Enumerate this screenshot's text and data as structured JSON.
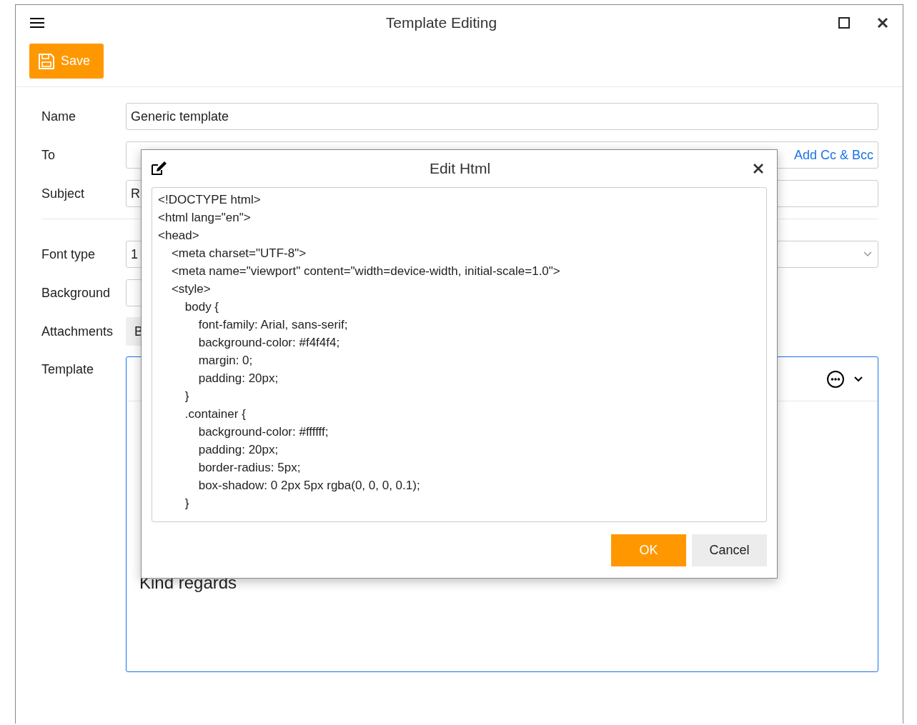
{
  "window": {
    "title": "Template Editing"
  },
  "toolbar": {
    "save_label": "Save"
  },
  "form": {
    "fields": [
      {
        "label": "Name",
        "value": "Generic template",
        "kind": "text"
      },
      {
        "label": "To",
        "kind": "to",
        "link": "Add Cc & Bcc"
      },
      {
        "label": "Subject",
        "value": "R",
        "kind": "text"
      }
    ],
    "style_fields": [
      {
        "label": "Font type",
        "value": "1",
        "kind": "select"
      },
      {
        "label": "Background",
        "kind": "text"
      },
      {
        "label": "Attachments",
        "value": "B",
        "kind": "button"
      }
    ],
    "template": {
      "label": "Template",
      "body": "Kind regards"
    }
  },
  "dialog": {
    "title": "Edit Html",
    "code_lines": [
      "<!DOCTYPE html>",
      "<html lang=\"en\">",
      "<head>",
      "    <meta charset=\"UTF-8\">",
      "    <meta name=\"viewport\" content=\"width=device-width, initial-scale=1.0\">",
      "    <style>",
      "        body {",
      "            font-family: Arial, sans-serif;",
      "            background-color: #f4f4f4;",
      "            margin: 0;",
      "            padding: 20px;",
      "        }",
      "        .container {",
      "            background-color: #ffffff;",
      "            padding: 20px;",
      "            border-radius: 5px;",
      "            box-shadow: 0 2px 5px rgba(0, 0, 0, 0.1);",
      "        }"
    ],
    "ok": "OK",
    "cancel": "Cancel"
  }
}
